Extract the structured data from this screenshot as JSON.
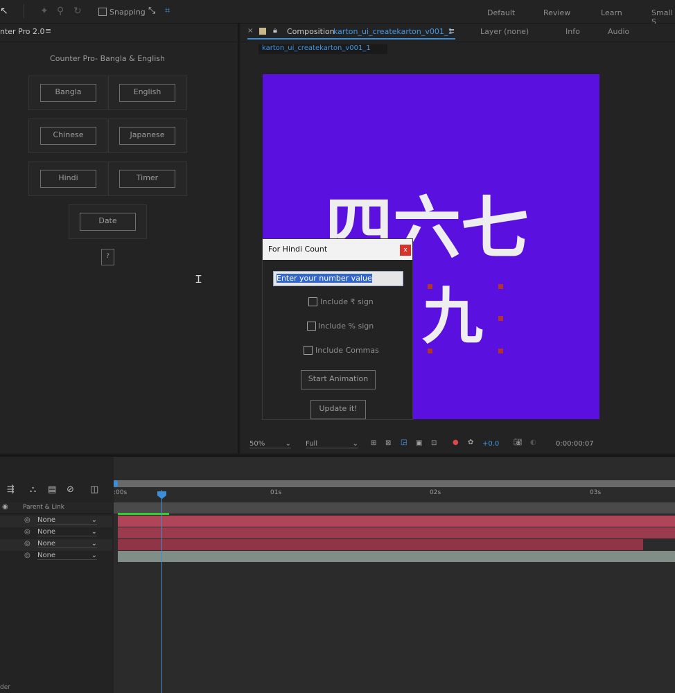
{
  "toolbar": {
    "snapping_label": "Snapping",
    "workspaces": [
      "Default",
      "Review",
      "Learn",
      "Small S"
    ]
  },
  "left_panel": {
    "tab_title": "nter Pro 2.0",
    "header": "Counter Pro- Bangla & English",
    "buttons": [
      "Bangla",
      "English",
      "Chinese",
      "Japanese",
      "Hindi",
      "Timer",
      "Date"
    ],
    "help": "?"
  },
  "comp_panel": {
    "tab_prefix": "Composition",
    "comp_name": "karton_ui_createkarton_v001_1",
    "layer_tab": "Layer (none)",
    "info_tab": "Info",
    "audio_tab": "Audio",
    "breadcrumb": "karton_ui_createkarton_v001_1",
    "canvas_color": "#5a10de",
    "canvas_text_line1": "四六七",
    "canvas_text_line2": "九"
  },
  "dialog": {
    "title": "For Hindi Count",
    "close": "x",
    "input_value": "Enter your number value",
    "checkboxes": [
      "Include ₹ sign",
      "Include % sign",
      "Include Commas"
    ],
    "start_button": "Start Animation",
    "update_button": "Update it!"
  },
  "comp_footer": {
    "zoom": "50%",
    "resolution": "Full",
    "exposure": "+0.0",
    "timecode": "0:00:00:07"
  },
  "timeline": {
    "parent_header": "Parent & Link",
    "rows": [
      "None",
      "None",
      "None",
      "None"
    ],
    "ruler": [
      ":00s",
      "01s",
      "02s",
      "03s"
    ],
    "bottom_left": "der"
  }
}
